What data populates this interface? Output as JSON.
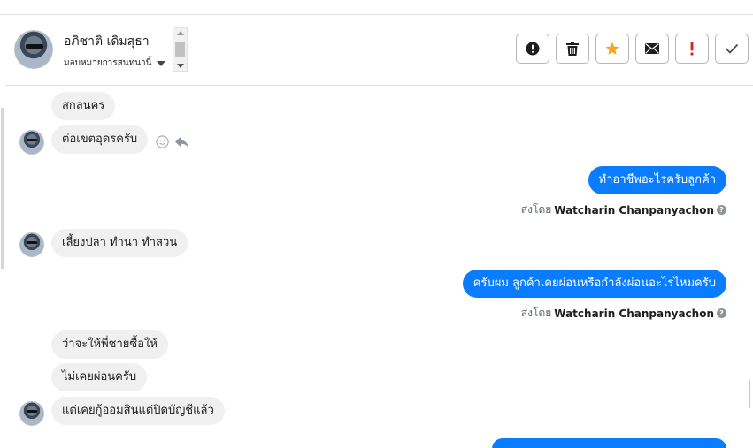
{
  "header": {
    "contact_name": "อภิชาติ เดิมสุธา",
    "assign_label": "มอบหมายการสนทนานี้"
  },
  "actions": [
    {
      "name": "mark-spam",
      "icon": "exclamation-circle-icon"
    },
    {
      "name": "delete",
      "icon": "trash-icon"
    },
    {
      "name": "star",
      "icon": "star-icon",
      "color": "#f5a623"
    },
    {
      "name": "mark-unread",
      "icon": "envelope-icon"
    },
    {
      "name": "follow-up",
      "icon": "exclamation-icon",
      "color": "#e02020"
    },
    {
      "name": "done",
      "icon": "check-icon"
    }
  ],
  "messages": [
    {
      "from": "customer",
      "text": "สกลนคร"
    },
    {
      "from": "customer",
      "text": "ต่อเขตอุดรครับ"
    },
    {
      "from": "page",
      "text": "ทำอาชีพอะไรครับลูกค้า"
    },
    {
      "from": "customer",
      "text": "เลี้ยงปลา ทำนา ทำสวน"
    },
    {
      "from": "page",
      "text": "ครับผม ลูกค้าเคยผ่อนหรือกำลังผ่อนอะไรไหมครับ"
    },
    {
      "from": "customer",
      "text": "ว่าจะให้พี่ชายซื้อให้"
    },
    {
      "from": "customer",
      "text": "ไม่เคยผ่อนครับ"
    },
    {
      "from": "customer",
      "text": "แต่เคยกู้ออมสินแต่ปิดบัญชีแล้ว"
    }
  ],
  "sent_by": {
    "prefix": "ส่งโดย",
    "agent": "Watcharin Chanpanyachon",
    "help": "?"
  },
  "colors": {
    "outgoing_bubble": "#0a7cff",
    "incoming_bubble": "#f0f0f0"
  }
}
